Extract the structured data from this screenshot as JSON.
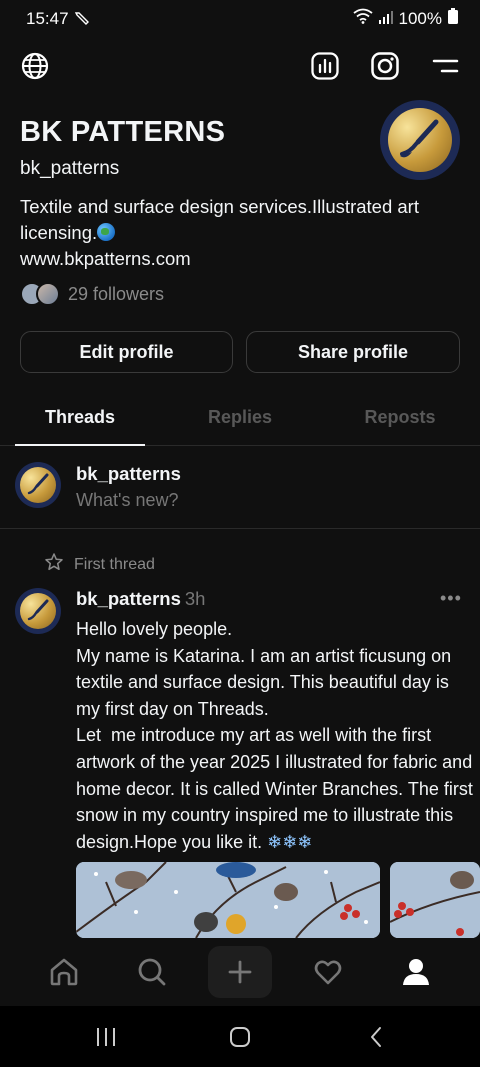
{
  "status_bar": {
    "time": "15:47",
    "battery": "100%"
  },
  "top_bar": {
    "icons": [
      "globe-icon",
      "insights-icon",
      "instagram-icon",
      "menu-icon"
    ]
  },
  "profile": {
    "name": "BK PATTERNS",
    "handle": "bk_patterns",
    "bio": "Textile and surface design services.Illustrated art licensing.",
    "website": "www.bkpatterns.com",
    "followers": "29 followers"
  },
  "buttons": {
    "edit": "Edit profile",
    "share": "Share profile"
  },
  "tabs": [
    {
      "label": "Threads",
      "active": true
    },
    {
      "label": "Replies",
      "active": false
    },
    {
      "label": "Reposts",
      "active": false
    }
  ],
  "composer": {
    "username": "bk_patterns",
    "placeholder": "What's new?"
  },
  "thread": {
    "pinned_label": "First thread",
    "username": "bk_patterns",
    "time_ago": "3h",
    "more": "•••",
    "body": "Hello lovely people.\nMy name is Katarina. I am an artist ficusung on textile and surface design. This beautiful day is my first day on Threads.\nLet  me introduce my art as well with the first artwork of the year 2025 I illustrated for fabric and home decor. It is called Winter Branches. The first snow in my country inspired me to illustrate this design.Hope you like it. ",
    "snow": "❄❄❄"
  },
  "bottom_nav": [
    "home-icon",
    "search-icon",
    "create-icon",
    "activity-icon",
    "profile-icon"
  ],
  "colors": {
    "background": "#101010",
    "text": "#f3f5f7",
    "muted": "#585858",
    "border": "#3a3a3a"
  }
}
